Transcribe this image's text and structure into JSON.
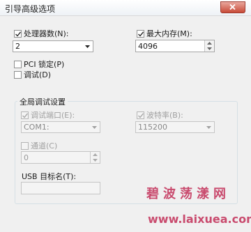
{
  "window": {
    "title": "引导高级选项"
  },
  "processors": {
    "checkbox_label": "处理器数(N):",
    "checked": true,
    "selected": "2"
  },
  "max_memory": {
    "checkbox_label": "最大内存(M):",
    "checked": true,
    "value": "4096"
  },
  "pci_lock": {
    "label": "PCI 锁定(P)",
    "checked": false
  },
  "debug": {
    "label": "调试(D)",
    "checked": false
  },
  "global_debug": {
    "group_title": "全局调试设置",
    "debug_port": {
      "label": "调试端口(E):",
      "checked": true,
      "enabled": false,
      "selected": "COM1:"
    },
    "baud_rate": {
      "label": "波特率(B):",
      "checked": true,
      "enabled": false,
      "selected": "115200"
    },
    "channel": {
      "label": "通道(C)",
      "checked": false,
      "enabled": false,
      "value": "0"
    },
    "usb_target": {
      "label": "USB 目标名(T):",
      "value": ""
    }
  },
  "watermark": {
    "line1": "碧波荡漾网",
    "line2": "www.laixuea.com"
  }
}
